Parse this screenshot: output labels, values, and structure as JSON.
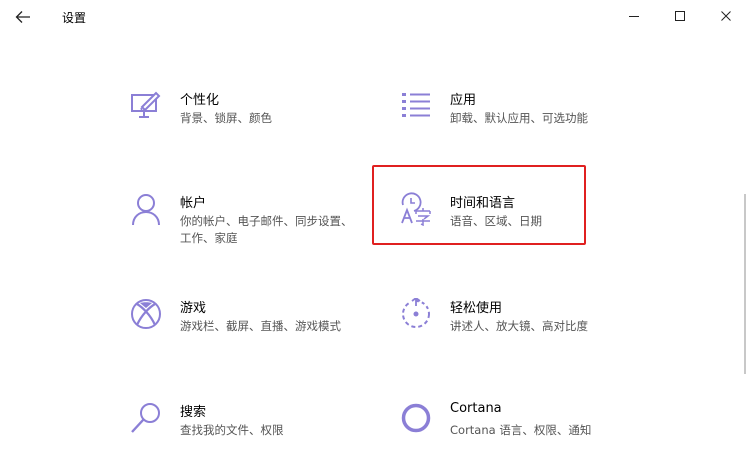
{
  "window": {
    "title": "设置"
  },
  "tiles": [
    {
      "title": "个性化",
      "desc": "背景、锁屏、颜色",
      "icon": "personalization-icon"
    },
    {
      "title": "应用",
      "desc": "卸载、默认应用、可选功能",
      "icon": "apps-icon"
    },
    {
      "title": "帐户",
      "desc": "你的帐户、电子邮件、同步设置、工作、家庭",
      "icon": "account-icon"
    },
    {
      "title": "时间和语言",
      "desc": "语音、区域、日期",
      "icon": "time-language-icon"
    },
    {
      "title": "游戏",
      "desc": "游戏栏、截屏、直播、游戏模式",
      "icon": "xbox-icon"
    },
    {
      "title": "轻松使用",
      "desc": "讲述人、放大镜、高对比度",
      "icon": "ease-of-access-icon"
    },
    {
      "title": "搜索",
      "desc": "查找我的文件、权限",
      "icon": "search-icon"
    },
    {
      "title": "Cortana",
      "desc": "Cortana 语言、权限、通知",
      "icon": "cortana-icon"
    }
  ],
  "colors": {
    "accent": "#8b7fd6",
    "highlight_border": "#e02020"
  }
}
